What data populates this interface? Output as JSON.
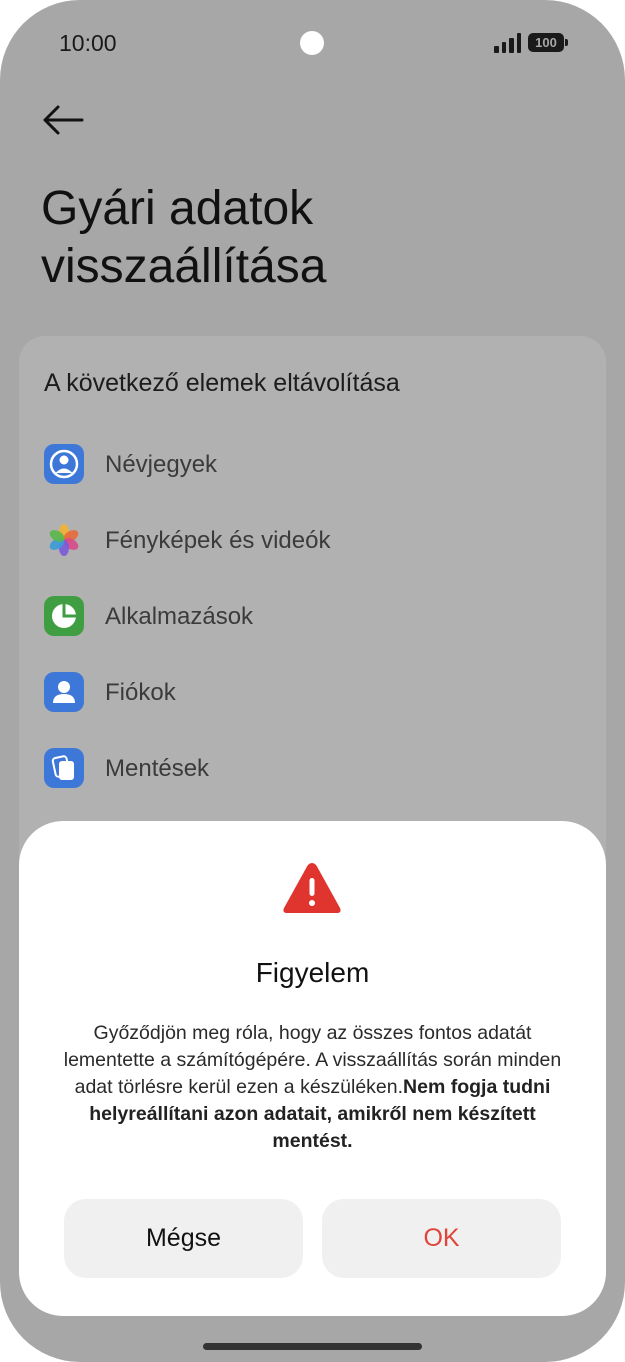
{
  "status_bar": {
    "time": "10:00",
    "battery": "100"
  },
  "header": {
    "title": "Gyári adatok visszaállítása"
  },
  "removal_card": {
    "title": "A következő elemek eltávolítása",
    "items": [
      {
        "label": "Névjegyek",
        "icon": "contacts-icon",
        "color": "#3d78d8"
      },
      {
        "label": "Fényképek és videók",
        "icon": "photos-icon",
        "color": "#e86a3a"
      },
      {
        "label": "Alkalmazások",
        "icon": "apps-icon",
        "color": "#3f9e41"
      },
      {
        "label": "Fiókok",
        "icon": "accounts-icon",
        "color": "#3d78d8"
      },
      {
        "label": "Mentések",
        "icon": "backup-icon",
        "color": "#3d78d8"
      }
    ]
  },
  "dialog": {
    "icon": "warning-icon",
    "title": "Figyelem",
    "body_regular": "Győződjön meg róla, hogy az összes fontos adatát lementette a számítógépére. A visszaállítás során minden adat törlésre kerül ezen a készüléken.",
    "body_bold": "Nem fogja tudni helyreállítani azon adatait, amikről nem készített mentést.",
    "cancel_label": "Mégse",
    "ok_label": "OK",
    "ok_color": "#e0443a"
  }
}
